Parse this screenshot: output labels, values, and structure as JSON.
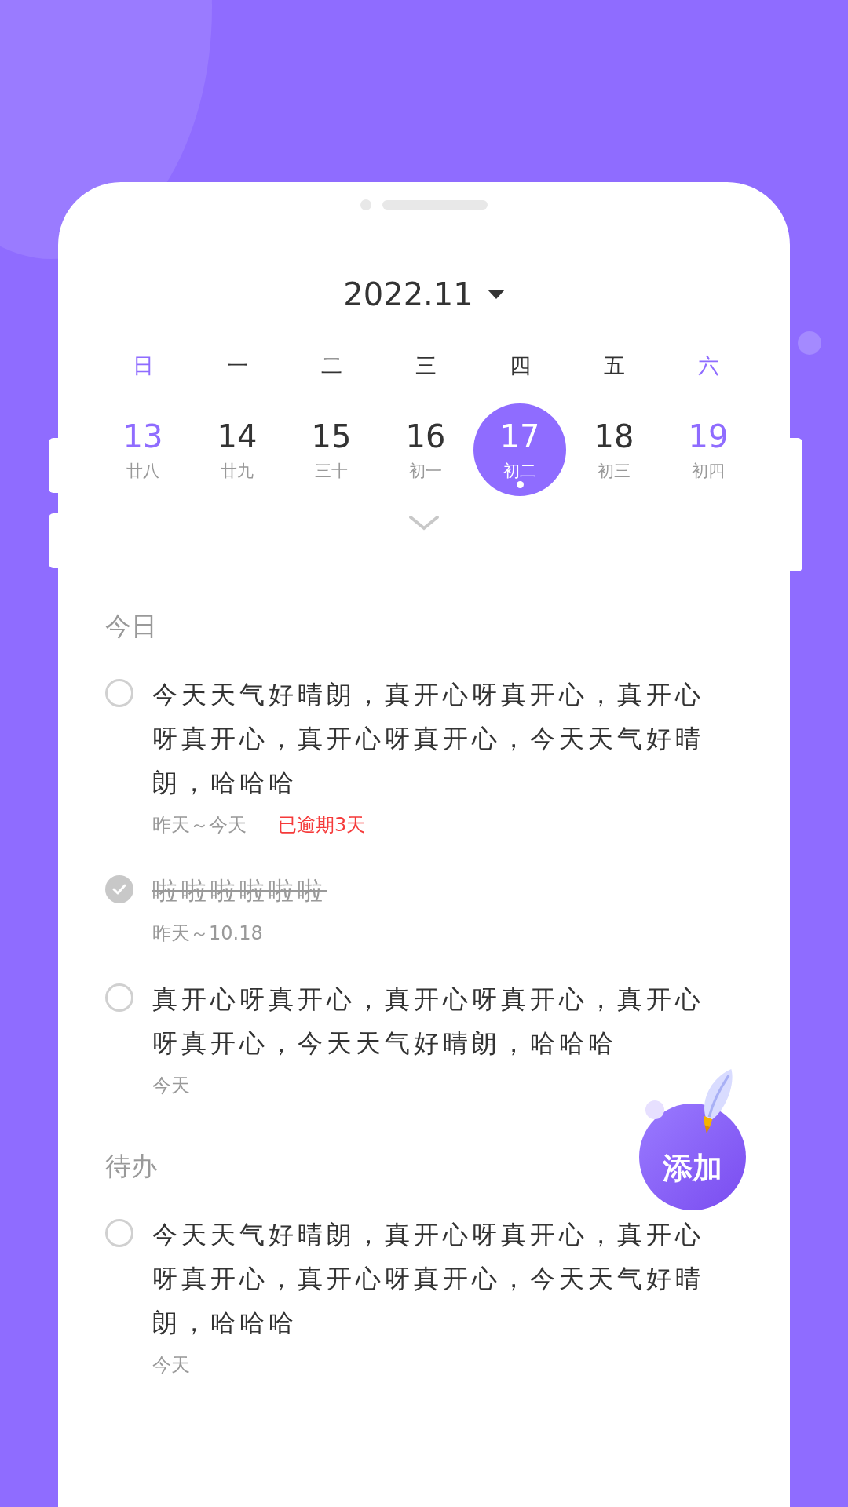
{
  "month": "2022.11",
  "weekdays": [
    {
      "label": "日",
      "weekend": true
    },
    {
      "label": "一",
      "weekend": false
    },
    {
      "label": "二",
      "weekend": false
    },
    {
      "label": "三",
      "weekend": false
    },
    {
      "label": "四",
      "weekend": false
    },
    {
      "label": "五",
      "weekend": false
    },
    {
      "label": "六",
      "weekend": true
    }
  ],
  "days": [
    {
      "day": "13",
      "lunar": "廿八",
      "weekend": true,
      "selected": false
    },
    {
      "day": "14",
      "lunar": "廿九",
      "weekend": false,
      "selected": false
    },
    {
      "day": "15",
      "lunar": "三十",
      "weekend": false,
      "selected": false
    },
    {
      "day": "16",
      "lunar": "初一",
      "weekend": false,
      "selected": false
    },
    {
      "day": "17",
      "lunar": "初二",
      "weekend": false,
      "selected": true
    },
    {
      "day": "18",
      "lunar": "初三",
      "weekend": false,
      "selected": false
    },
    {
      "day": "19",
      "lunar": "初四",
      "weekend": true,
      "selected": false
    }
  ],
  "sections": [
    {
      "title": "今日",
      "items": [
        {
          "text": "今天天气好晴朗，真开心呀真开心，真开心呀真开心，真开心呀真开心，今天天气好晴朗，哈哈哈",
          "done": false,
          "date": "昨天～今天",
          "overdue": "已逾期3天"
        },
        {
          "text": "啦啦啦啦啦啦",
          "done": true,
          "date": "昨天～10.18"
        },
        {
          "text": "真开心呀真开心，真开心呀真开心，真开心呀真开心，今天天气好晴朗，哈哈哈",
          "done": false,
          "date": "今天"
        }
      ]
    },
    {
      "title": "待办",
      "items": [
        {
          "text": "今天天气好晴朗，真开心呀真开心，真开心呀真开心，真开心呀真开心，今天天气好晴朗，哈哈哈",
          "done": false,
          "date": "今天"
        }
      ]
    }
  ],
  "add_button": "添加"
}
